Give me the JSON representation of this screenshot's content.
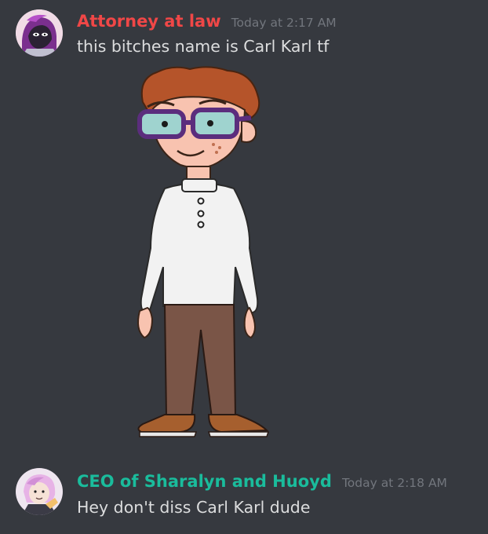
{
  "messages": [
    {
      "username": "Attorney at law",
      "username_color": "#f04747",
      "timestamp": "Today at 2:17 AM",
      "text": "this bitches name is Carl Karl tf",
      "avatar_icon": "purple-haired-character-avatar"
    },
    {
      "username": "CEO of Sharalyn and Huoyd",
      "username_color": "#1abc9c",
      "timestamp": "Today at 2:18 AM",
      "text": "Hey don't diss Carl Karl dude",
      "avatar_icon": "pink-haired-character-avatar"
    }
  ],
  "attachment": {
    "icon": "cartoon-boy-glasses-image"
  },
  "colors": {
    "background": "#36393f",
    "text": "#dcddde",
    "timestamp": "#72767d"
  }
}
